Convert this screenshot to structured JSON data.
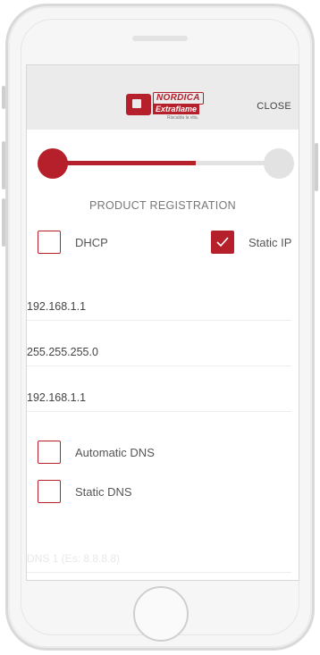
{
  "header": {
    "brand_top": "NORDICA",
    "brand_mid": "Extraflame",
    "brand_tag": "Riscalda la vita.",
    "close_label": "CLOSE"
  },
  "progress": {
    "current_step": 1,
    "total_steps": 2,
    "fill_fraction": 0.63,
    "accent_color": "#b5202a",
    "track_color": "#e2e2e2"
  },
  "page": {
    "title": "PRODUCT REGISTRATION"
  },
  "network_mode": {
    "dhcp_label": "DHCP",
    "dhcp_checked": false,
    "static_ip_label": "Static IP",
    "static_ip_checked": true
  },
  "fields": {
    "ip_address": "192.168.1.1",
    "subnet_mask": "255.255.255.0",
    "gateway": "192.168.1.1"
  },
  "dns_mode": {
    "automatic_label": "Automatic DNS",
    "automatic_checked": false,
    "static_label": "Static DNS",
    "static_checked": false
  },
  "dns1": {
    "placeholder": "DNS 1 (Es: 8.8.8.8)"
  }
}
